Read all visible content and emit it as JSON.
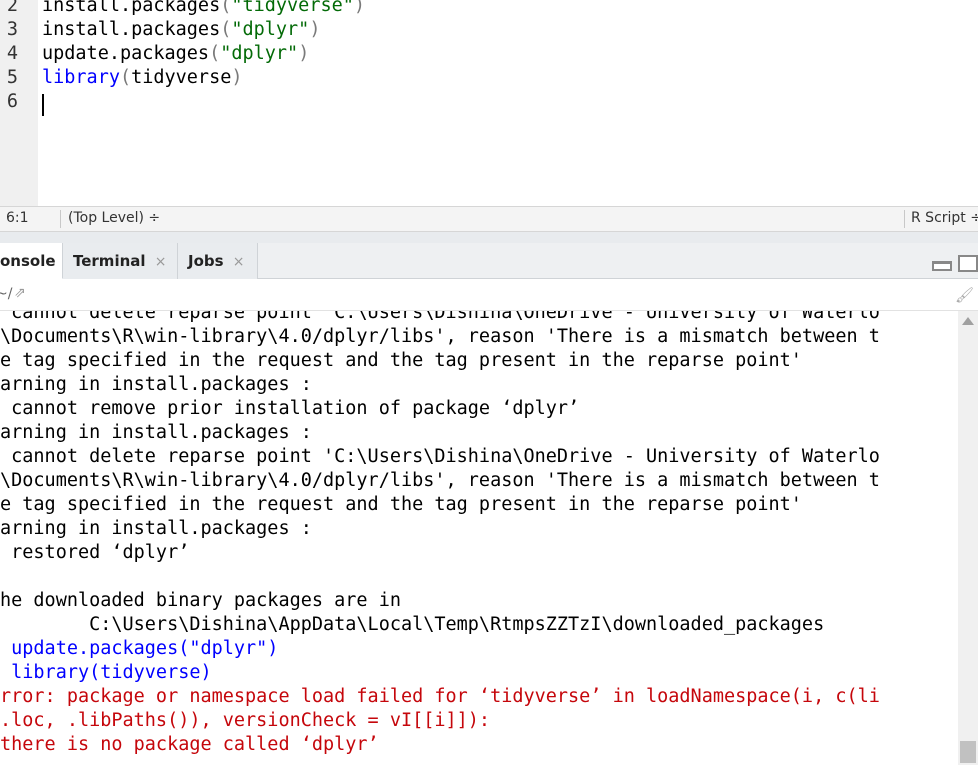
{
  "editor": {
    "lines": [
      {
        "num": "2",
        "parts": [
          {
            "t": "install.packages",
            "c": ""
          },
          {
            "t": "(",
            "c": "tok-paren"
          },
          {
            "t": "\"tidyverse\"",
            "c": "tok-str"
          },
          {
            "t": ")",
            "c": "tok-paren"
          }
        ]
      },
      {
        "num": "3",
        "parts": [
          {
            "t": "install.packages",
            "c": ""
          },
          {
            "t": "(",
            "c": "tok-paren"
          },
          {
            "t": "\"dplyr\"",
            "c": "tok-str"
          },
          {
            "t": ")",
            "c": "tok-paren"
          }
        ]
      },
      {
        "num": "4",
        "parts": [
          {
            "t": "update.packages",
            "c": ""
          },
          {
            "t": "(",
            "c": "tok-paren"
          },
          {
            "t": "\"dplyr\"",
            "c": "tok-str"
          },
          {
            "t": ")",
            "c": "tok-paren"
          }
        ]
      },
      {
        "num": "5",
        "parts": [
          {
            "t": "library",
            "c": "tok-kw"
          },
          {
            "t": "(",
            "c": "tok-paren"
          },
          {
            "t": "tidyverse",
            "c": ""
          },
          {
            "t": ")",
            "c": "tok-paren"
          }
        ]
      },
      {
        "num": "6",
        "parts": []
      }
    ]
  },
  "statusbar": {
    "position": "6:1",
    "scope": "(Top Level) ÷",
    "file_type": "R Script ÷"
  },
  "tabs": {
    "console": "onsole",
    "terminal": "Terminal",
    "jobs": "Jobs",
    "close_glyph": "×"
  },
  "consolebar": {
    "working_dir": "~/",
    "nav_arrow": "⇗",
    "clear_icon": "🖌"
  },
  "console": {
    "lines": [
      {
        "text": " cannot delete reparse point 'C:\\Users\\Dishina\\OneDrive - University of Waterlo",
        "type": "output"
      },
      {
        "text": "\\Documents\\R\\win-library\\4.0/dplyr/libs', reason 'There is a mismatch between t",
        "type": "output"
      },
      {
        "text": "e tag specified in the request and the tag present in the reparse point'",
        "type": "output"
      },
      {
        "text": "arning in install.packages :",
        "type": "output"
      },
      {
        "text": " cannot remove prior installation of package ‘dplyr’",
        "type": "output"
      },
      {
        "text": "arning in install.packages :",
        "type": "output"
      },
      {
        "text": " cannot delete reparse point 'C:\\Users\\Dishina\\OneDrive - University of Waterlo",
        "type": "output"
      },
      {
        "text": "\\Documents\\R\\win-library\\4.0/dplyr/libs', reason 'There is a mismatch between t",
        "type": "output"
      },
      {
        "text": "e tag specified in the request and the tag present in the reparse point'",
        "type": "output"
      },
      {
        "text": "arning in install.packages :",
        "type": "output"
      },
      {
        "text": " restored ‘dplyr’",
        "type": "output"
      },
      {
        "text": "",
        "type": "output"
      },
      {
        "text": "he downloaded binary packages are in",
        "type": "output"
      },
      {
        "text": "        C:\\Users\\Dishina\\AppData\\Local\\Temp\\RtmpsZZTzI\\downloaded_packages",
        "type": "output"
      },
      {
        "text": " update.packages(\"dplyr\")",
        "type": "input"
      },
      {
        "text": " library(tidyverse)",
        "type": "input"
      },
      {
        "text": "rror: package or namespace load failed for ‘tidyverse’ in loadNamespace(i, c(li",
        "type": "error"
      },
      {
        "text": ".loc, .libPaths()), versionCheck = vI[[i]]):",
        "type": "error"
      },
      {
        "text": "there is no package called ‘dplyr’",
        "type": "error"
      }
    ]
  }
}
